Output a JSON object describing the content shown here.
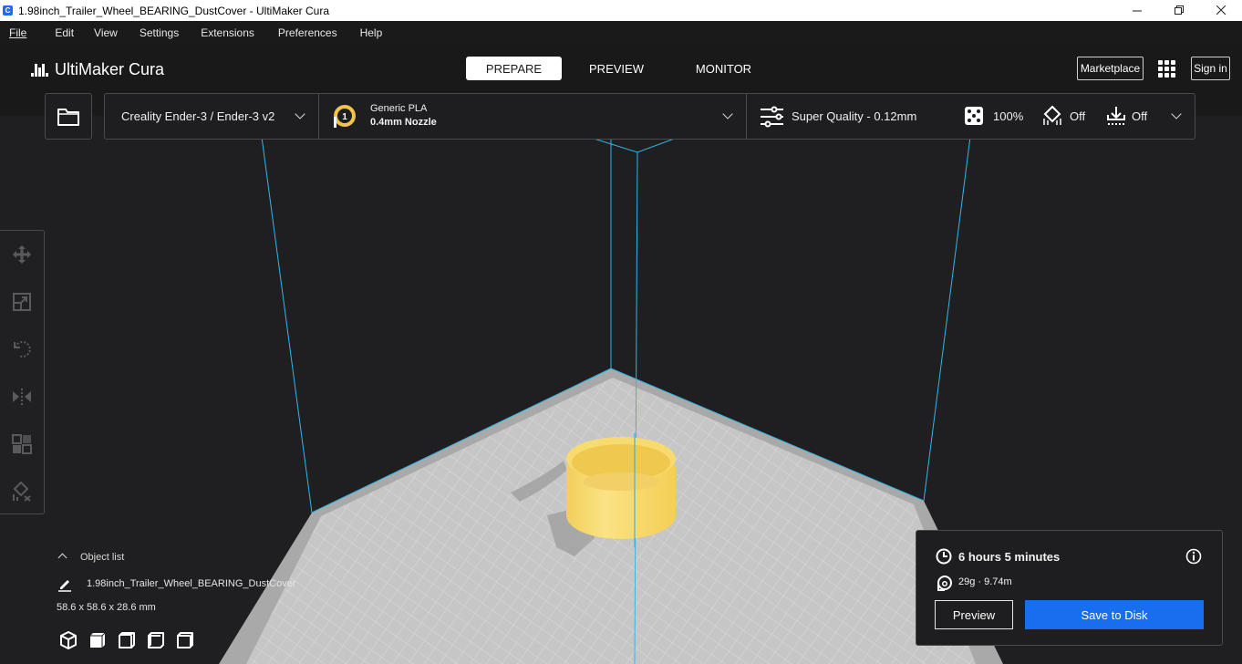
{
  "window": {
    "title": "1.98inch_Trailer_Wheel_BEARING_DustCover - UltiMaker Cura",
    "controls": [
      "minimize",
      "restore",
      "close"
    ]
  },
  "menu": {
    "items": [
      {
        "label": "File",
        "accel": "F"
      },
      {
        "label": "Edit",
        "accel": "E"
      },
      {
        "label": "View",
        "accel": "V"
      },
      {
        "label": "Settings",
        "accel": "S"
      },
      {
        "label": "Extensions",
        "accel": "x"
      },
      {
        "label": "Preferences",
        "accel": "r"
      },
      {
        "label": "Help",
        "accel": "H"
      }
    ]
  },
  "header": {
    "logo": "UltiMaker Cura",
    "stages": [
      {
        "label": "PREPARE",
        "active": true
      },
      {
        "label": "PREVIEW",
        "active": false
      },
      {
        "label": "MONITOR",
        "active": false
      }
    ],
    "marketplace_label": "Marketplace",
    "signin_label": "Sign in"
  },
  "config": {
    "printer": "Creality Ender-3 / Ender-3 v2",
    "extruder_number": "1",
    "material": "Generic PLA",
    "nozzle": "0.4mm Nozzle",
    "profile": "Super Quality - 0.12mm",
    "infill": "100%",
    "support": "Off",
    "adhesion": "Off"
  },
  "tools": [
    "move",
    "scale",
    "rotate",
    "mirror",
    "per-model-settings",
    "support-blocker"
  ],
  "object_list": {
    "header": "Object list",
    "object_name": "1.98inch_Trailer_Wheel_BEARING_DustCover",
    "dimensions": "58.6 x 58.6 x 28.6 mm",
    "view_buttons": [
      "3d-view",
      "front-view",
      "top-view",
      "left-view",
      "right-view"
    ]
  },
  "print_info": {
    "time": "6 hours 5 minutes",
    "material_usage": "29g · 9.74m",
    "preview_label": "Preview",
    "save_label": "Save to Disk"
  },
  "colors": {
    "accent": "#196ef0",
    "model": "#f7d86a",
    "build_volume_lines": "#33b5e5",
    "build_plate": "#c8c8c8"
  }
}
